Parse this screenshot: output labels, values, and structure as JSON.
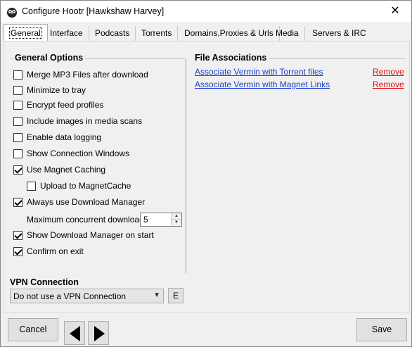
{
  "window": {
    "title": "Configure Hootr [Hawkshaw Harvey]",
    "close_glyph": "✕",
    "app_icon": "owl-icon"
  },
  "tabs": [
    {
      "label": "General",
      "active": true
    },
    {
      "label": "Interface"
    },
    {
      "label": "Podcasts"
    },
    {
      "label": "Torrents"
    },
    {
      "label": "Domains,Proxies & Urls"
    },
    {
      "label": "Media"
    },
    {
      "label": "Servers & IRC"
    }
  ],
  "general": {
    "title": "General Options",
    "options": [
      {
        "label": "Merge MP3 Files after download",
        "checked": false
      },
      {
        "label": "Minimize to tray",
        "checked": false
      },
      {
        "label": "Encrypt feed profiles",
        "checked": false
      },
      {
        "label": "Include images in media scans",
        "checked": false
      },
      {
        "label": "Enable data logging",
        "checked": false
      },
      {
        "label": "Show Connection Windows",
        "checked": false
      },
      {
        "label": "Use Magnet Caching",
        "checked": true
      },
      {
        "label": "Upload to MagnetCache",
        "checked": false
      },
      {
        "label": "Always use Download Manager",
        "checked": true
      },
      {
        "label": "Show Download Manager on start",
        "checked": true
      },
      {
        "label": "Confirm on exit",
        "checked": true
      }
    ],
    "max_downloads_label": "Maximum concurrent downloads",
    "max_downloads_value": "5"
  },
  "file_assoc": {
    "title": "File Associations",
    "items": [
      {
        "label": "Associate Vermin with Torrent files",
        "action": "Remove"
      },
      {
        "label": "Associate Vermin with Magnet Links",
        "action": "Remove"
      }
    ]
  },
  "vpn": {
    "title": "VPN Connection",
    "selected": "Do not use a VPN Connection",
    "edit_label": "E"
  },
  "footer": {
    "cancel_label": "Cancel",
    "save_label": "Save"
  },
  "colors": {
    "link": "#1a3ecf",
    "remove": "#e01010"
  }
}
